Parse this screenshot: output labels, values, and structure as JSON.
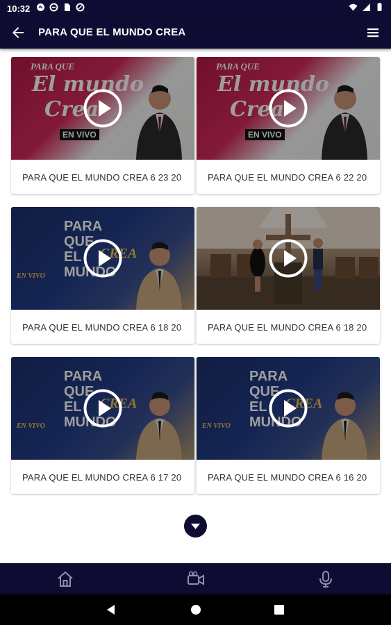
{
  "status_bar": {
    "time": "10:32",
    "left_icons": [
      "notification-icon",
      "data-saver-icon",
      "sim-card-icon",
      "data-saver-icon"
    ],
    "right_icons": [
      "wifi-icon",
      "signal-icon",
      "battery-icon"
    ]
  },
  "app_bar": {
    "title": "PARA QUE EL MUNDO CREA",
    "back_icon": "arrow-back-icon",
    "menu_icon": "hamburger-menu-icon",
    "background": "#0f0c33"
  },
  "videos": [
    {
      "title": "PARA QUE EL MUNDO CREA 6 23 20",
      "thumbnail": "pink-promo",
      "thumb_lines": [
        "PARA QUE",
        "El mundo",
        "Crea",
        "EN VIVO"
      ]
    },
    {
      "title": "PARA QUE EL MUNDO CREA 6 22 20",
      "thumbnail": "pink-promo",
      "thumb_lines": [
        "PARA QUE",
        "El mundo",
        "Crea",
        "EN VIVO"
      ]
    },
    {
      "title": "PARA QUE EL MUNDO CREA 6 18 20",
      "thumbnail": "blue-promo",
      "thumb_lines": [
        "PARA",
        "QUE",
        "EL",
        "MUNDO",
        "CREA",
        "EN VIVO"
      ]
    },
    {
      "title": "PARA QUE EL MUNDO CREA 6 18 20",
      "thumbnail": "church-stage",
      "thumb_lines": []
    },
    {
      "title": "PARA QUE EL MUNDO CREA 6 17 20",
      "thumbnail": "blue-promo",
      "thumb_lines": [
        "PARA",
        "QUE",
        "EL",
        "MUNDO",
        "CREA",
        "EN VIVO"
      ]
    },
    {
      "title": "PARA QUE EL MUNDO CREA 6 16 20",
      "thumbnail": "blue-promo",
      "thumb_lines": [
        "PARA",
        "QUE",
        "EL",
        "MUNDO",
        "CREA",
        "EN VIVO"
      ]
    }
  ],
  "load_more_icon": "chevron-down-icon",
  "bottom_nav": {
    "items": [
      {
        "name": "home",
        "icon": "home-icon"
      },
      {
        "name": "video",
        "icon": "video-camera-icon"
      },
      {
        "name": "audio",
        "icon": "microphone-icon"
      }
    ]
  },
  "system_nav": [
    "back-triangle-icon",
    "home-circle-icon",
    "recents-square-icon"
  ],
  "colors": {
    "primary": "#0f0c33",
    "card_text": "#333333",
    "thumb_pink": "#c21f4e",
    "thumb_blue": "#1d2f6c"
  }
}
